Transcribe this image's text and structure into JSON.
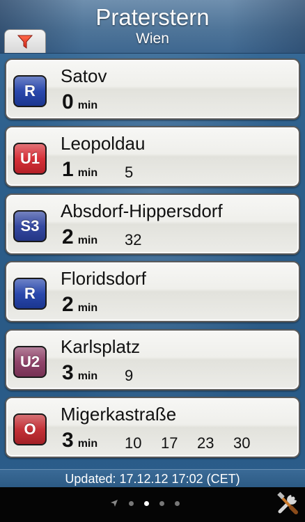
{
  "header": {
    "station": "Praterstern",
    "city": "Wien"
  },
  "departures": [
    {
      "line": "R",
      "line_color": "#1f3fa8",
      "destination": "Satov",
      "minutes": "0",
      "unit": "min",
      "next": []
    },
    {
      "line": "U1",
      "line_color": "#d4262e",
      "destination": "Leopoldau",
      "minutes": "1",
      "unit": "min",
      "next": [
        "5"
      ]
    },
    {
      "line": "S3",
      "line_color": "#2a3f9c",
      "destination": "Absdorf-Hippersdorf",
      "minutes": "2",
      "unit": "min",
      "next": [
        "32"
      ]
    },
    {
      "line": "R",
      "line_color": "#1f3fa8",
      "destination": "Floridsdorf",
      "minutes": "2",
      "unit": "min",
      "next": []
    },
    {
      "line": "U2",
      "line_color": "#8a3a62",
      "destination": "Karlsplatz",
      "minutes": "3",
      "unit": "min",
      "next": [
        "9"
      ]
    },
    {
      "line": "O",
      "line_color": "#c0262c",
      "destination": "Migerkastraße",
      "minutes": "3",
      "unit": "min",
      "next": [
        "10",
        "17",
        "23",
        "30"
      ]
    }
  ],
  "footer": {
    "updated": "Updated: 17.12.12 17:02 (CET)"
  },
  "pager": {
    "pages": 5,
    "active": 3
  },
  "icons": {
    "filter": "filter-funnel-icon",
    "location": "location-arrow-icon",
    "settings": "tools-icon"
  }
}
